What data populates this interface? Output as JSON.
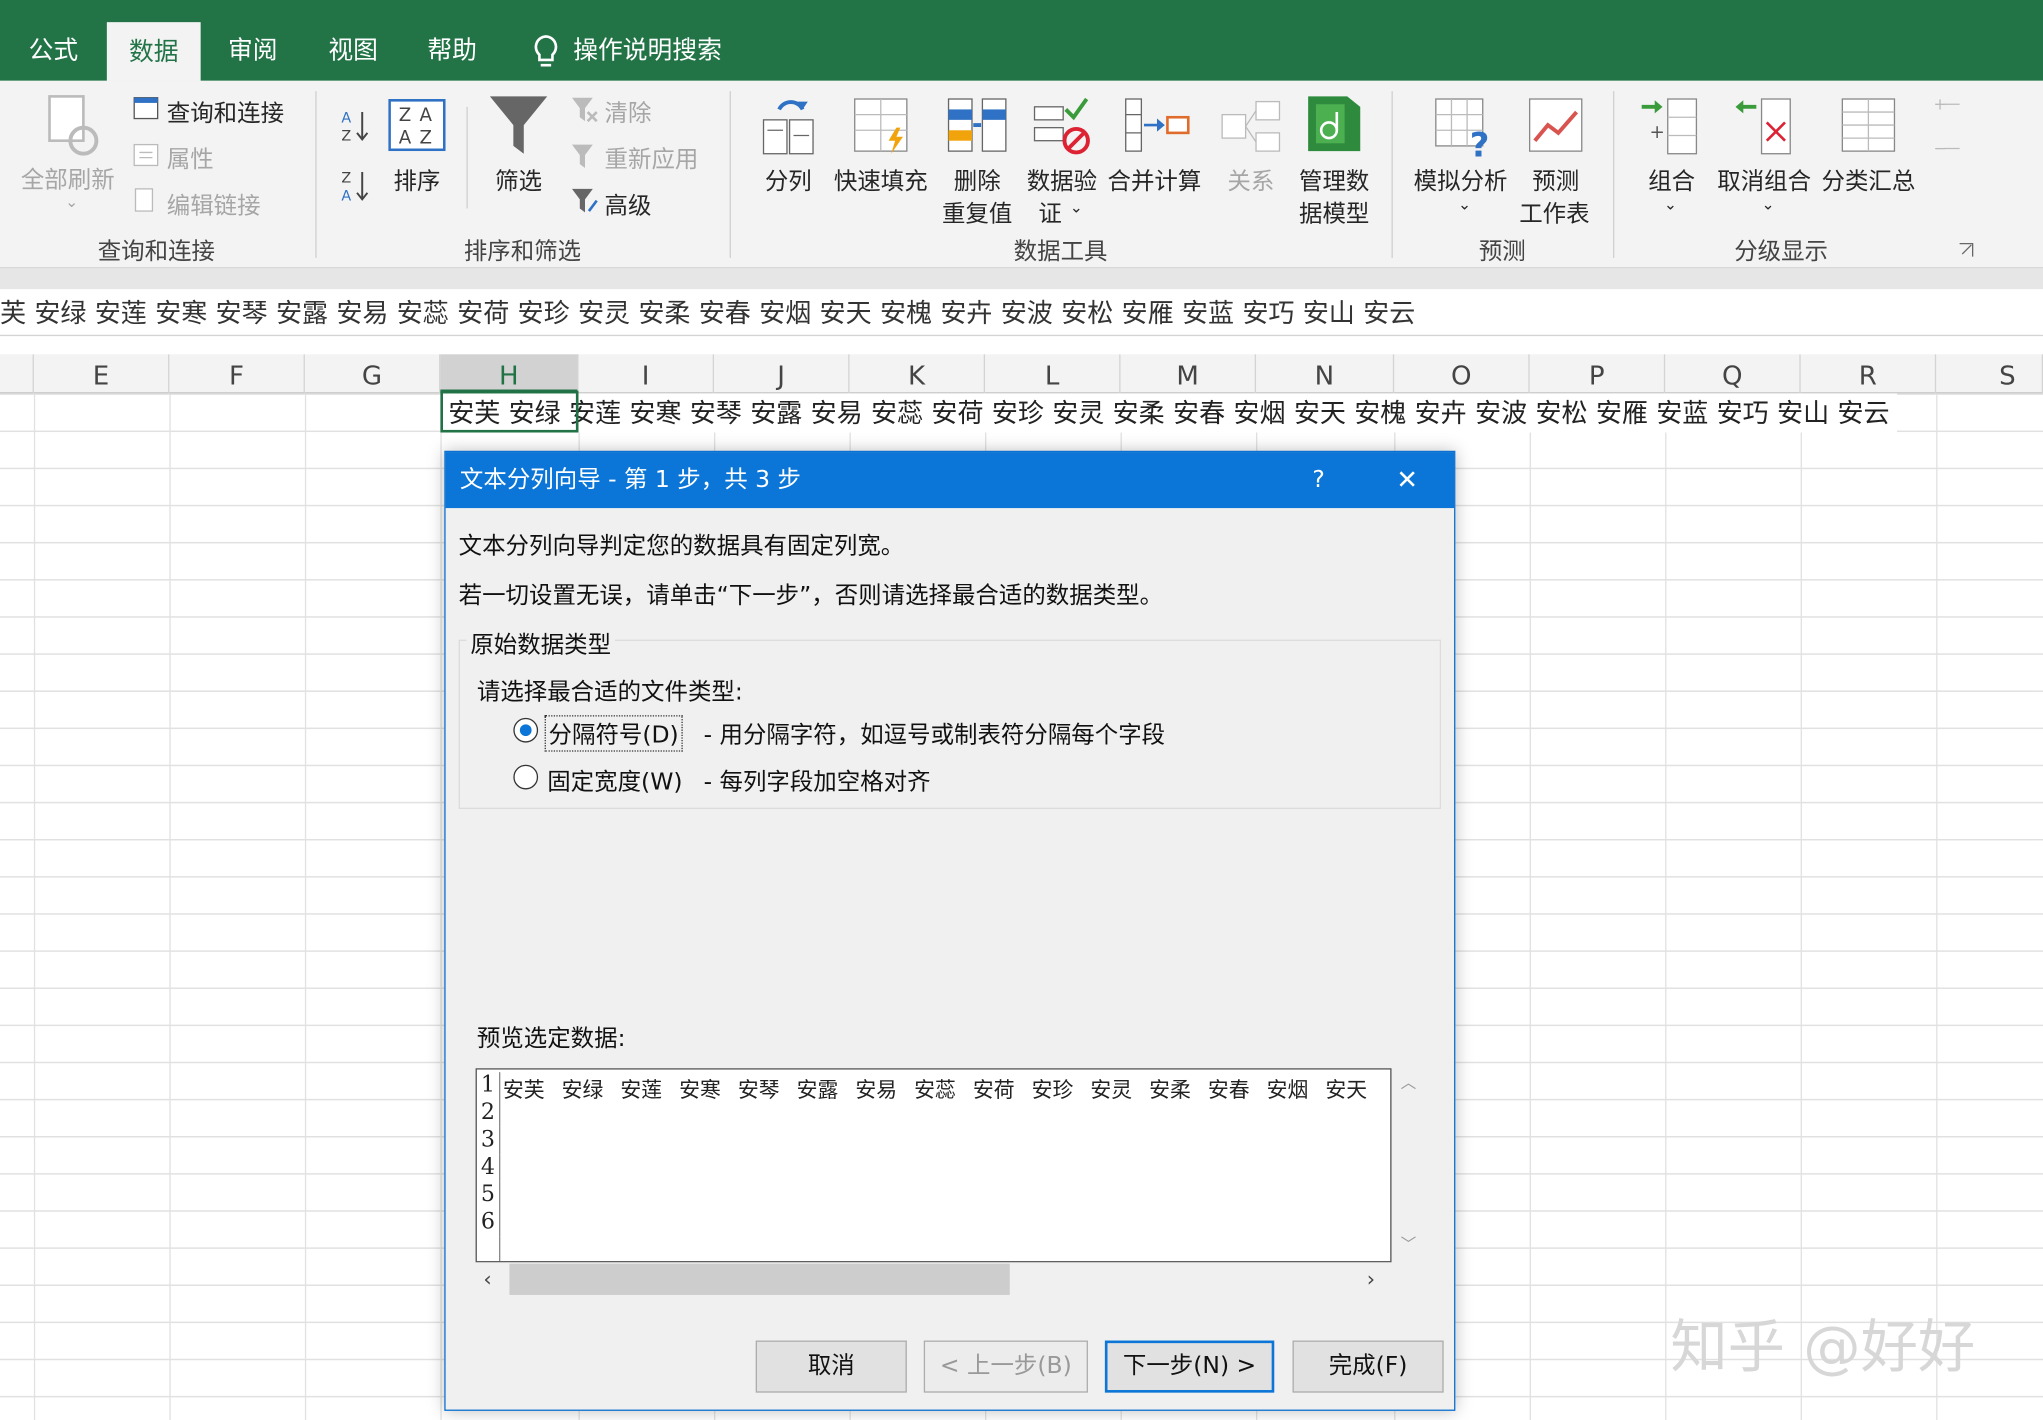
{
  "tabs": [
    {
      "label": "公式"
    },
    {
      "label": "数据"
    },
    {
      "label": "审阅"
    },
    {
      "label": "视图"
    },
    {
      "label": "帮助"
    }
  ],
  "tell_me": "操作说明搜索",
  "ribbon": {
    "query": {
      "refresh_all": "全部刷新",
      "queries_connections": "查询和连接",
      "properties": "属性",
      "edit_links": "编辑链接",
      "group": "查询和连接"
    },
    "sort": {
      "sort": "排序",
      "filter": "筛选",
      "clear": "清除",
      "reapply": "重新应用",
      "advanced": "高级",
      "group": "排序和筛选"
    },
    "tools": {
      "text_to_columns": "分列",
      "flash_fill": "快速填充",
      "remove_dup_1": "删除",
      "remove_dup_2": "重复值",
      "validation_1": "数据验",
      "validation_2": "证",
      "consolidate": "合并计算",
      "relationships": "关系",
      "data_model_1": "管理数",
      "data_model_2": "据模型",
      "group": "数据工具"
    },
    "forecast": {
      "what_if": "模拟分析",
      "forecast_1": "预测",
      "forecast_2": "工作表",
      "group": "预测"
    },
    "outline": {
      "group_btn": "组合",
      "ungroup": "取消组合",
      "subtotal": "分类汇总",
      "group": "分级显示"
    }
  },
  "formula_bar": "芙 安绿 安莲 安寒 安琴 安露 安易 安蕊 安荷 安珍 安灵 安柔 安春 安烟 安天 安槐 安卉 安波 安松 安雁 安蓝 安巧 安山 安云",
  "columns": [
    "E",
    "F",
    "G",
    "H",
    "I",
    "J",
    "K",
    "L",
    "M",
    "N",
    "O",
    "P",
    "Q",
    "R",
    "S"
  ],
  "cell_content": "安芙 安绿 安莲 安寒 安琴 安露 安易 安蕊 安荷 安珍 安灵 安柔 安春 安烟 安天 安槐 安卉 安波 安松 安雁 安蓝 安巧 安山 安云",
  "dialog": {
    "title": "文本分列向导 - 第 1 步，共 3 步",
    "help": "?",
    "close": "✕",
    "line1": "文本分列向导判定您的数据具有固定列宽。",
    "line2": "若一切设置无误，请单击“下一步”，否则请选择最合适的数据类型。",
    "group_title": "原始数据类型",
    "choose_label": "请选择最合适的文件类型:",
    "opt_delimited": "分隔符号(D)",
    "opt_delimited_desc": "- 用分隔字符，如逗号或制表符分隔每个字段",
    "opt_fixed": "固定宽度(W)",
    "opt_fixed_desc": "- 每列字段加空格对齐",
    "preview_label": "预览选定数据:",
    "preview_rows": [
      "1",
      "2",
      "3",
      "4",
      "5",
      "6"
    ],
    "preview_line": "安芙 安绿 安莲 安寒 安琴 安露 安易 安蕊 安荷 安珍 安灵 安柔 安春 安烟 安天",
    "cancel": "取消",
    "back": "< 上一步(B)",
    "next": "下一步(N) >",
    "finish": "完成(F)",
    "selected_option": "delimited"
  },
  "watermark": "知乎 @好好",
  "colors": {
    "excel_green": "#227447",
    "dialog_blue": "#0b76d7"
  }
}
